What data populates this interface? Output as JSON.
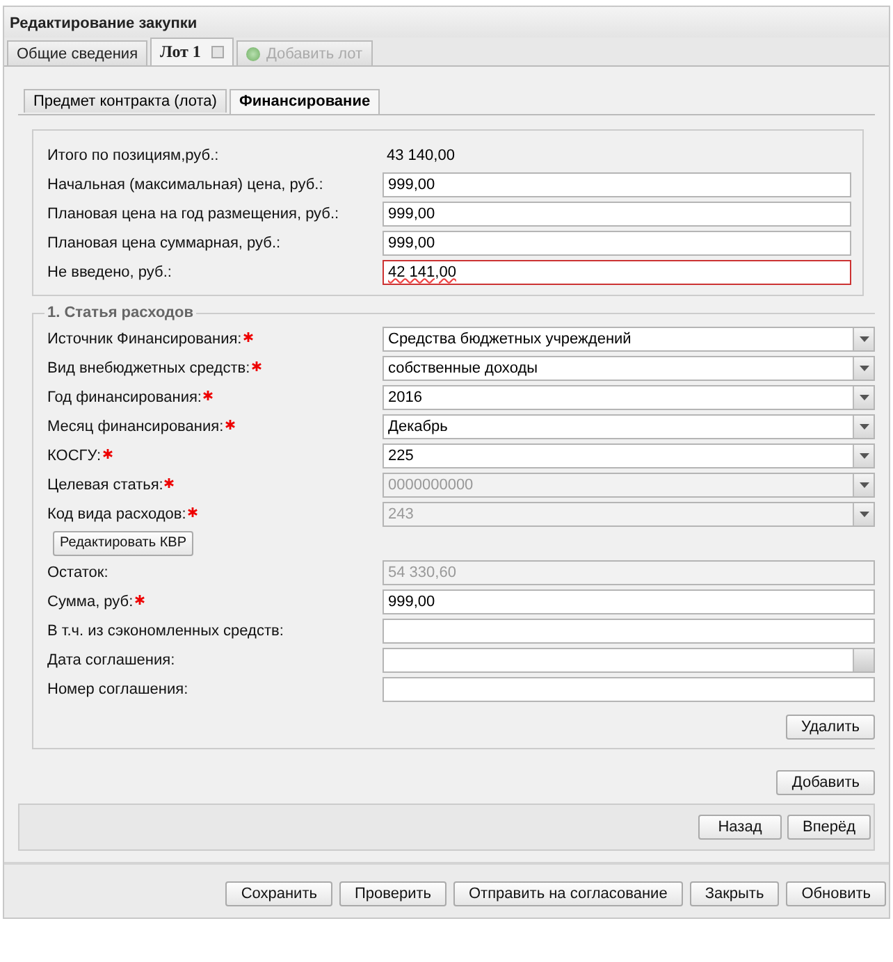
{
  "window": {
    "title": "Редактирование закупки"
  },
  "tabs": [
    {
      "label": "Общие сведения",
      "kind": "tab",
      "selected": false,
      "closable": false,
      "disabled": false
    },
    {
      "label": "Лот 1",
      "kind": "tab",
      "selected": true,
      "closable": true,
      "disabled": false
    },
    {
      "label": "Добавить лот",
      "kind": "add",
      "selected": false,
      "closable": false,
      "disabled": true
    }
  ],
  "subtabs": [
    {
      "label": "Предмет контракта (лота)",
      "selected": false
    },
    {
      "label": "Финансирование",
      "selected": true
    }
  ],
  "totals": [
    {
      "label": "Итого по позициям,руб.:",
      "kind": "text",
      "value": "43 140,00"
    },
    {
      "label": "Начальная (максимальная) цена, руб.:",
      "kind": "input",
      "value": "999,00"
    },
    {
      "label": "Плановая цена на год размещения, руб.:",
      "kind": "input",
      "value": "999,00"
    },
    {
      "label": "Плановая цена суммарная, руб.:",
      "kind": "input",
      "value": "999,00"
    },
    {
      "label": "Не введено, руб.:",
      "kind": "input",
      "value": "42 141,00",
      "invalid": true
    }
  ],
  "section": {
    "legend": "1. Статья расходов",
    "fields": [
      {
        "label": "Источник Финансирования:",
        "required": true,
        "kind": "combo",
        "value": "Средства бюджетных учреждений",
        "disabled": false
      },
      {
        "label": "Вид внебюджетных средств:",
        "required": true,
        "kind": "combo",
        "value": "собственные доходы",
        "disabled": false
      },
      {
        "label": "Год финансирования:",
        "required": true,
        "kind": "combo",
        "value": "2016",
        "disabled": false
      },
      {
        "label": "Месяц финансирования:",
        "required": true,
        "kind": "combo",
        "value": "Декабрь",
        "disabled": false
      },
      {
        "label": "КОСГУ:",
        "required": true,
        "kind": "combo",
        "value": "225",
        "disabled": false
      },
      {
        "label": "Целевая статья:",
        "required": true,
        "kind": "combo",
        "value": "0000000000",
        "disabled": true
      },
      {
        "label": "Код вида расходов:",
        "required": true,
        "kind": "combo",
        "value": "243",
        "disabled": true
      },
      {
        "label": "Редактировать КВР",
        "kind": "button"
      },
      {
        "label": "Остаток:",
        "required": false,
        "kind": "input",
        "value": "54 330,60",
        "disabled": true
      },
      {
        "label": "Сумма, руб:",
        "required": true,
        "kind": "input",
        "value": "999,00",
        "disabled": false
      },
      {
        "label": "В т.ч. из сэкономленных средств:",
        "required": false,
        "kind": "input",
        "disabled": false
      },
      {
        "label": "Дата соглашения:",
        "required": false,
        "kind": "date",
        "disabled": false
      },
      {
        "label": "Номер соглашения:",
        "required": false,
        "kind": "input",
        "disabled": false
      }
    ],
    "delete_button": "Удалить"
  },
  "add_button": "Добавить",
  "nav_buttons": [
    "Назад",
    "Вперёд"
  ],
  "footer_buttons": [
    "Сохранить",
    "Проверить",
    "Отправить на согласование",
    "Закрыть",
    "Обновить"
  ]
}
